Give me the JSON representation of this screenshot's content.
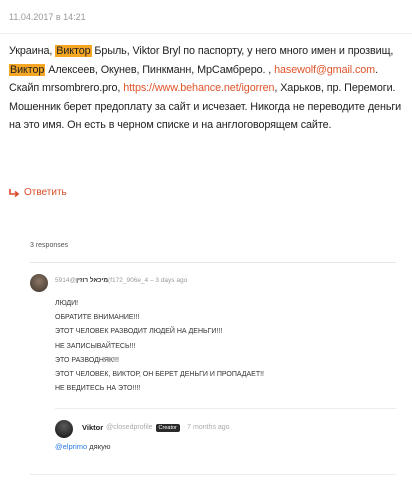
{
  "post": {
    "date": "11.04.2017 в 14:21",
    "t1": "Украина, ",
    "h1": "Виктор",
    "t2": " Брыль, Viktor Bryl по паспорту, у него много имен и прозвищ, ",
    "h2": "Виктор",
    "t3": " Алексеев, Окунев, Пинкманн, МрСамбреро. , ",
    "email": "hasewolf@gmail.com",
    "t4": ". Скайп mrsombrero.pro, ",
    "url": "https://www.behance.net/igorren",
    "t5": ", Харьков, пр. Перемоги. Мошенник берет предоплату за сайт и исчезает. Никогда не переводите деньги на это имя. Он есть в черном списке и на англоговорящем сайте.",
    "reply_label": "Ответить"
  },
  "responses_label": "3 responses",
  "comment1": {
    "handle": "5914@",
    "name": "מיכאל רוזין",
    "id_suffix": "(f172_906e_4",
    "time": " – 3 days ago",
    "lines": [
      "ЛЮДИ!",
      "ОБРАТИТЕ ВНИМАНИЕ!!!",
      "ЭТОТ ЧЕЛОВЕК РАЗВОДИТ ЛЮДЕЙ НА ДЕНЬГИ!!!",
      "НЕ ЗАПИСЫВАЙТЕСЬ!!!",
      "ЭТО РАЗВОДНЯК!!!",
      "ЭТОТ ЧЕЛОВЕК, ВИКТОР, ОН БЕРЕТ ДЕНЬГИ И ПРОПАДАЕТ!!",
      "НЕ ВЕДИТЕСЬ НА ЭТО!!!!"
    ]
  },
  "comment2": {
    "name": "Viktor",
    "handle": "@closedprofile",
    "badge": "Creator",
    "time": "· 7 months ago",
    "mention": "@elprimo",
    "text": " дякую"
  },
  "colors": {
    "highlight": "#f5a623",
    "link": "#e0542b",
    "mention": "#2a7ae2"
  }
}
